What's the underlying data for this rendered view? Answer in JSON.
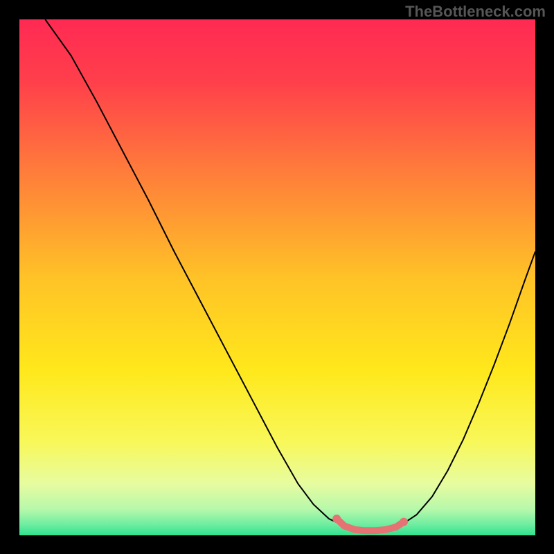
{
  "watermark": "TheBottleneck.com",
  "chart_data": {
    "type": "line",
    "title": "",
    "xlabel": "",
    "ylabel": "",
    "xlim": [
      0,
      100
    ],
    "ylim": [
      0,
      100
    ],
    "background_gradient": {
      "stops": [
        {
          "offset": 0.0,
          "color": "#ff2a53"
        },
        {
          "offset": 0.12,
          "color": "#ff3f4b"
        },
        {
          "offset": 0.3,
          "color": "#ff7e3a"
        },
        {
          "offset": 0.5,
          "color": "#ffc227"
        },
        {
          "offset": 0.68,
          "color": "#ffe81b"
        },
        {
          "offset": 0.82,
          "color": "#f8f85a"
        },
        {
          "offset": 0.9,
          "color": "#e7fca0"
        },
        {
          "offset": 0.95,
          "color": "#b6f8ab"
        },
        {
          "offset": 0.98,
          "color": "#6ceda0"
        },
        {
          "offset": 1.0,
          "color": "#2fe28f"
        }
      ]
    },
    "series": [
      {
        "name": "bottleneck-curve-left",
        "stroke": "#000000",
        "stroke_width": 2,
        "x": [
          5,
          10,
          15,
          20,
          25,
          30,
          35,
          40,
          45,
          50,
          54,
          57,
          60,
          63
        ],
        "y": [
          100,
          93,
          84,
          74.5,
          65,
          55,
          45.5,
          36,
          26.5,
          17,
          10,
          6,
          3.2,
          1.8
        ]
      },
      {
        "name": "bottleneck-curve-right",
        "stroke": "#000000",
        "stroke_width": 2,
        "x": [
          74,
          77,
          80,
          83,
          86,
          89,
          92,
          95,
          98,
          100
        ],
        "y": [
          2.0,
          4.0,
          7.5,
          12.5,
          18.5,
          25.5,
          33,
          41,
          49.5,
          55
        ]
      },
      {
        "name": "optimal-range-marker",
        "stroke": "#e57373",
        "stroke_width": 10,
        "linecap": "round",
        "x": [
          61.5,
          63,
          65,
          67,
          69,
          71,
          73,
          74.5
        ],
        "y": [
          3.2,
          1.8,
          1.1,
          0.9,
          0.9,
          1.1,
          1.6,
          2.6
        ]
      }
    ],
    "end_dots": [
      {
        "x": 61.5,
        "y": 3.2,
        "r": 6,
        "color": "#e57373"
      },
      {
        "x": 74.5,
        "y": 2.6,
        "r": 6,
        "color": "#e57373"
      }
    ]
  }
}
